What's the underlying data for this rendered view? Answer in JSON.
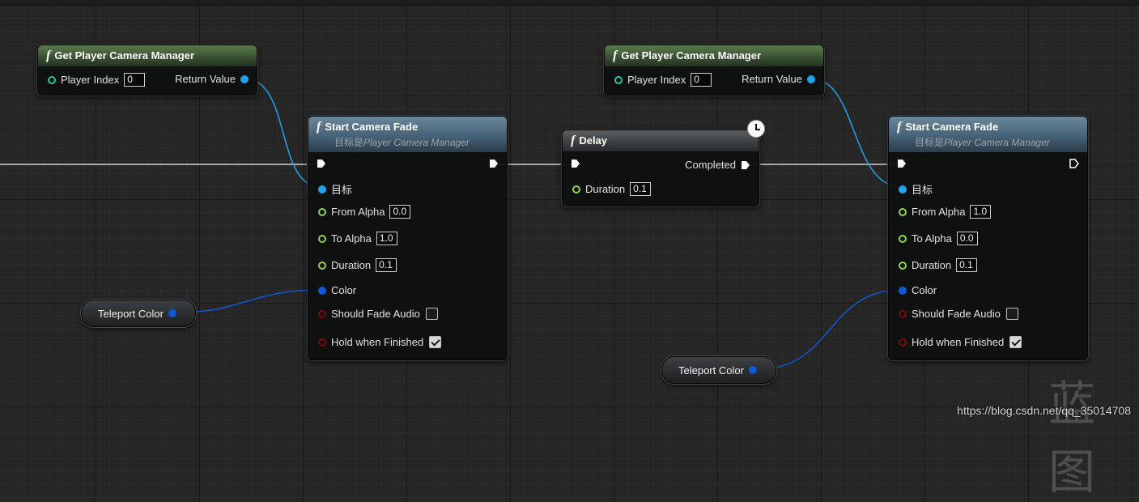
{
  "nodes": {
    "gpcm1": {
      "title": "Get Player Camera Manager",
      "player_index_label": "Player Index",
      "player_index_value": "0",
      "return_label": "Return Value"
    },
    "gpcm2": {
      "title": "Get Player Camera Manager",
      "player_index_label": "Player Index",
      "player_index_value": "0",
      "return_label": "Return Value"
    },
    "fade1": {
      "title": "Start Camera Fade",
      "subtitle_prefix": "目标是",
      "subtitle_target": "Player Camera Manager",
      "target_label": "目标",
      "from_alpha_label": "From Alpha",
      "from_alpha_value": "0.0",
      "to_alpha_label": "To Alpha",
      "to_alpha_value": "1.0",
      "duration_label": "Duration",
      "duration_value": "0.1",
      "color_label": "Color",
      "fade_audio_label": "Should Fade Audio",
      "fade_audio_checked": false,
      "hold_label": "Hold when Finished",
      "hold_checked": true
    },
    "delay": {
      "title": "Delay",
      "completed_label": "Completed",
      "duration_label": "Duration",
      "duration_value": "0.1"
    },
    "fade2": {
      "title": "Start Camera Fade",
      "subtitle_prefix": "目标是",
      "subtitle_target": "Player Camera Manager",
      "target_label": "目标",
      "from_alpha_label": "From Alpha",
      "from_alpha_value": "1.0",
      "to_alpha_label": "To Alpha",
      "to_alpha_value": "0.0",
      "duration_label": "Duration",
      "duration_value": "0.1",
      "color_label": "Color",
      "fade_audio_label": "Should Fade Audio",
      "fade_audio_checked": false,
      "hold_label": "Hold when Finished",
      "hold_checked": true
    },
    "var1": {
      "label": "Teleport Color"
    },
    "var2": {
      "label": "Teleport Color"
    }
  },
  "watermark": {
    "url": "https://blog.csdn.net/qq_35014708",
    "big_text": "蓝图"
  },
  "colors": {
    "object_pin": "#20a3ea",
    "float_pin": "#8cd54a",
    "int_pin": "#1fc7a5",
    "struct_pin": "#1157d6",
    "bool_pin": "#7a0c0c",
    "exec_wire": "#d9d9d9"
  }
}
